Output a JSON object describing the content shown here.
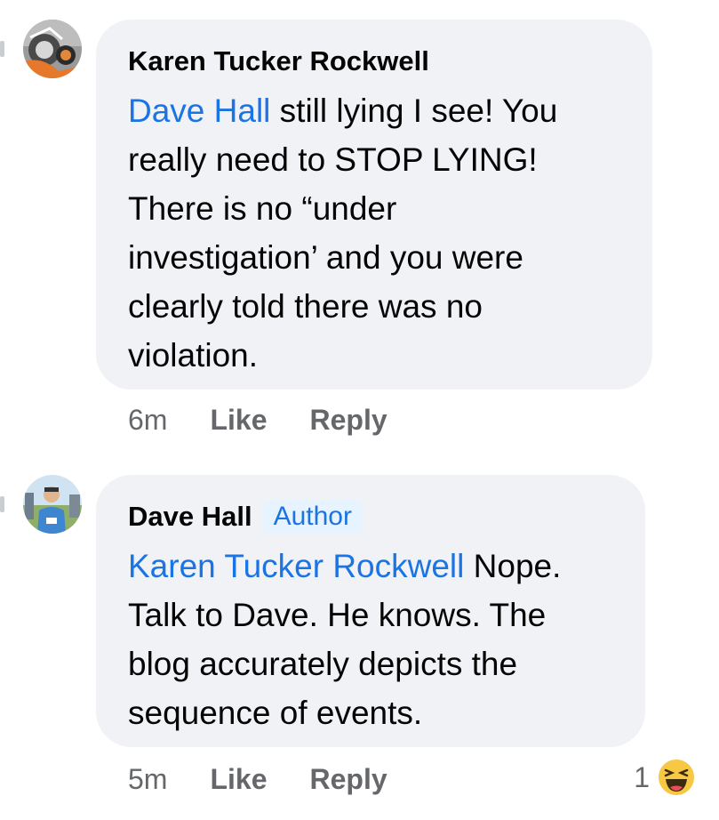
{
  "comments": [
    {
      "author": "Karen Tucker Rockwell",
      "mention": "Dave Hall",
      "text_lines": [
        " still lying I see!  You",
        "really need to STOP LYING!",
        "There is no “under",
        "investigation’ and you were",
        "clearly told there was no",
        "violation."
      ],
      "time": "6m",
      "like_label": "Like",
      "reply_label": "Reply"
    },
    {
      "author": "Dave Hall",
      "badge": "Author",
      "mention": "Karen Tucker Rockwell",
      "text_lines": [
        " Nope.",
        "Talk to Dave. He knows. The",
        "blog accurately depicts the",
        "sequence of events."
      ],
      "time": "5m",
      "like_label": "Like",
      "reply_label": "Reply",
      "reaction_count": "1",
      "reaction_icon": "haha-emoji-icon"
    }
  ],
  "colors": {
    "link": "#1b74e4",
    "bubble": "#f0f2f5",
    "meta": "#65676b"
  }
}
